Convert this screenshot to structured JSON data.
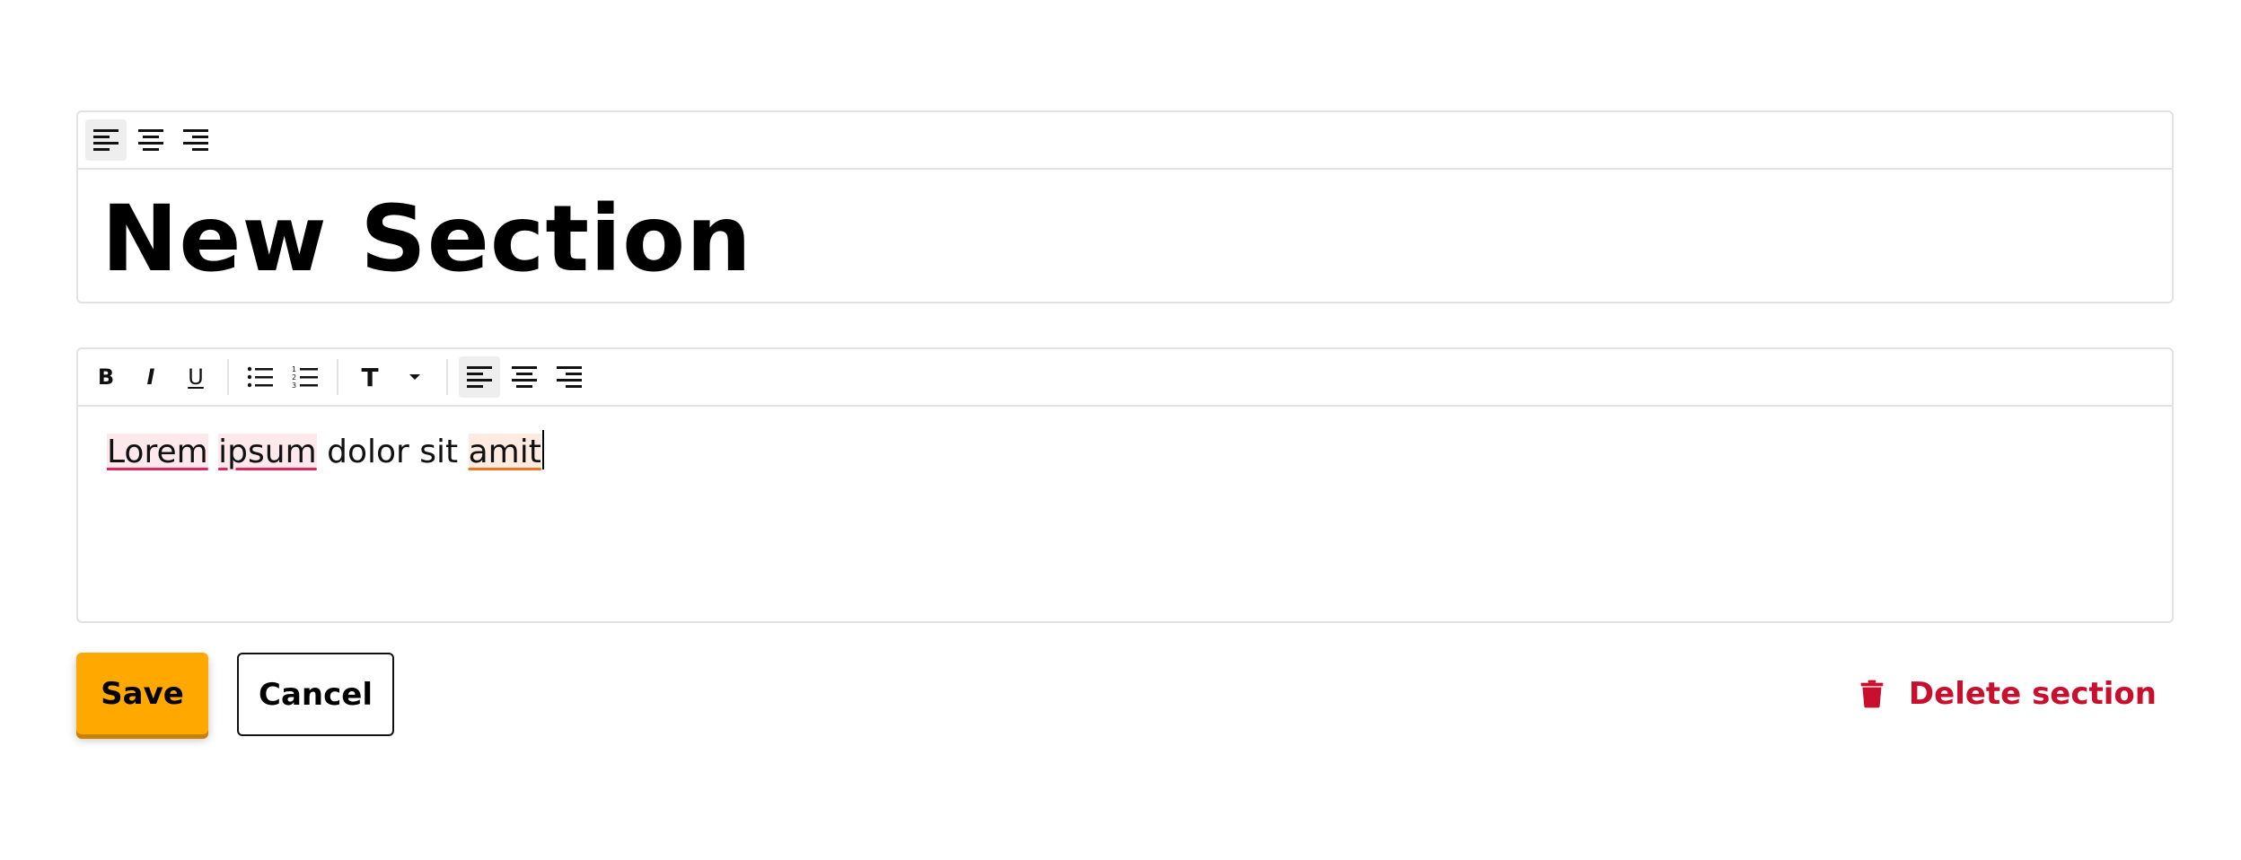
{
  "title_editor": {
    "toolbar": {
      "align_left": "align-left-icon",
      "align_center": "align-center-icon",
      "align_right": "align-right-icon"
    },
    "title": "New Section"
  },
  "body_editor": {
    "toolbar": {
      "bold_label": "B",
      "italic_label": "I",
      "underline_label": "U",
      "text_style_label": "T"
    },
    "content": {
      "word1": "Lorem",
      "word2": "ipsum",
      "middle": "dolor sit",
      "word3": "amit"
    }
  },
  "actions": {
    "save_label": "Save",
    "cancel_label": "Cancel",
    "delete_label": "Delete section"
  },
  "colors": {
    "save": "#ffa800",
    "delete": "#c8102e",
    "spell_error": "#e0245e",
    "spell_warning": "#f07324"
  }
}
